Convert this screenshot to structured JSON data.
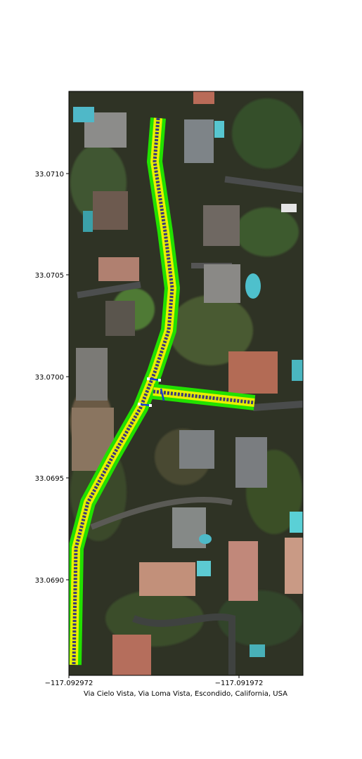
{
  "map": {
    "location_label": "Via Cielo Vista, Via Loma Vista, Escondido, California, USA",
    "x_ticks": [
      "−117.092972",
      "−117.091972"
    ],
    "y_ticks": [
      "33.0710",
      "33.0705",
      "33.0700",
      "33.0695",
      "33.0690"
    ],
    "colors": {
      "road_outer": "#22e000",
      "road_middle": "#e8f000",
      "road_center": "#3a3a7a",
      "intersection_marker": "#1a3fd0",
      "terrain_dark": "#2b2e22",
      "vegetation": "#3d5428",
      "roof_light": "#9a9aa0",
      "roof_terracotta": "#b8725a",
      "pool": "#4fc4c8"
    },
    "icons": [
      "intersection-marker-icon"
    ]
  }
}
